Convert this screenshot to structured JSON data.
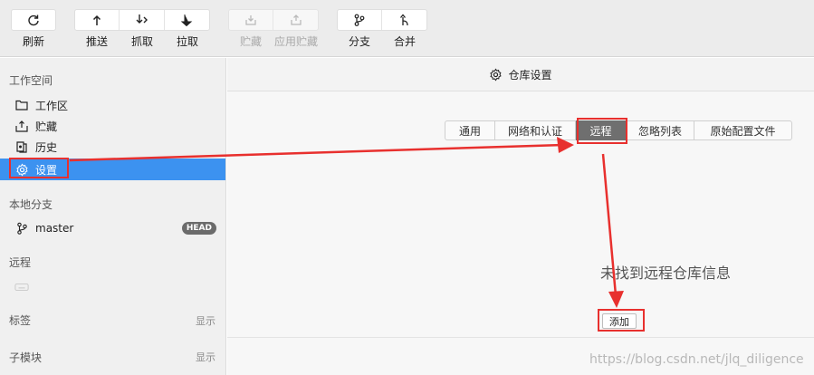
{
  "toolbar": {
    "refresh": {
      "label": "刷新",
      "icon": "refresh-icon"
    },
    "push": {
      "label": "推送",
      "icon": "push-icon"
    },
    "fetch": {
      "label": "抓取",
      "icon": "fetch-icon"
    },
    "pull": {
      "label": "拉取",
      "icon": "pull-icon"
    },
    "stash": {
      "label": "贮藏",
      "icon": "stash-icon",
      "disabled": true
    },
    "apply_stash": {
      "label": "应用贮藏",
      "icon": "apply-stash-icon",
      "disabled": true
    },
    "branch": {
      "label": "分支",
      "icon": "branch-icon"
    },
    "merge": {
      "label": "合并",
      "icon": "merge-icon"
    }
  },
  "sidebar": {
    "workspace_title": "工作空间",
    "workspace_items": [
      {
        "label": "工作区",
        "icon": "folder-icon"
      },
      {
        "label": "贮藏",
        "icon": "stash-icon"
      },
      {
        "label": "历史",
        "icon": "history-icon"
      },
      {
        "label": "设置",
        "icon": "gear-icon",
        "active": true
      }
    ],
    "local_branches_title": "本地分支",
    "local_branch": {
      "label": "master",
      "badge": "HEAD"
    },
    "remotes_title": "远程",
    "tags_title": "标签",
    "tags_toggle": "显示",
    "submodules_title": "子模块",
    "submodules_toggle": "显示"
  },
  "main": {
    "header_title": "仓库设置",
    "tabs": [
      {
        "label": "通用"
      },
      {
        "label": "网络和认证"
      },
      {
        "label": "远程",
        "active": true
      },
      {
        "label": "忽略列表"
      },
      {
        "label": "原始配置文件"
      }
    ],
    "empty_message": "未找到远程仓库信息",
    "add_button": "添加"
  },
  "watermark": "https://blog.csdn.net/jlq_diligence",
  "colors": {
    "accent": "#3c92f0",
    "annotation_red": "#e8302e",
    "active_tab": "#6f6f6f"
  }
}
